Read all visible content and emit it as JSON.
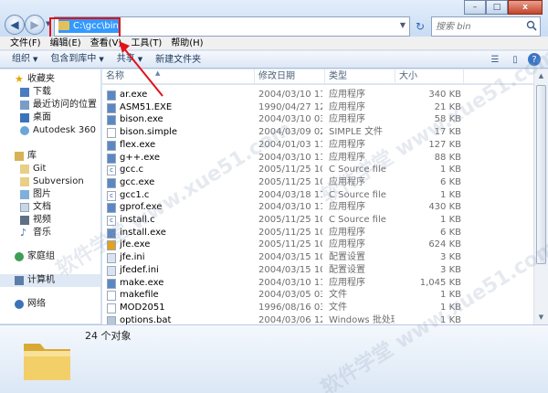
{
  "address": {
    "path": "C:\\gcc\\bin"
  },
  "search": {
    "placeholder": "搜索 bin"
  },
  "window_controls": {
    "minimize": "–",
    "maximize": "□",
    "close": "x"
  },
  "menu": [
    "文件(F)",
    "编辑(E)",
    "查看(V)",
    "工具(T)",
    "帮助(H)"
  ],
  "toolbar": {
    "organize": "组织",
    "include": "包含到库中",
    "share": "共享",
    "new_folder": "新建文件夹"
  },
  "nav": {
    "favorites": "收藏夹",
    "downloads": "下载",
    "recent": "最近访问的位置",
    "desktop": "桌面",
    "autodesk": "Autodesk 360",
    "libraries": "库",
    "git": "Git",
    "subversion": "Subversion",
    "pictures": "图片",
    "documents": "文档",
    "videos": "视频",
    "music": "音乐",
    "homegroup": "家庭组",
    "computer": "计算机",
    "network": "网络"
  },
  "columns": {
    "name": "名称",
    "date": "修改日期",
    "type": "类型",
    "size": "大小"
  },
  "files": [
    {
      "name": "ar.exe",
      "date": "2004/03/10 11:2...",
      "type": "应用程序",
      "size": "340 KB",
      "icon": "exe"
    },
    {
      "name": "ASM51.EXE",
      "date": "1990/04/27 12:4...",
      "type": "应用程序",
      "size": "21 KB",
      "icon": "exe"
    },
    {
      "name": "bison.exe",
      "date": "2004/03/10 03:4...",
      "type": "应用程序",
      "size": "58 KB",
      "icon": "exe"
    },
    {
      "name": "bison.simple",
      "date": "2004/03/09 02:5...",
      "type": "SIMPLE 文件",
      "size": "17 KB",
      "icon": "file"
    },
    {
      "name": "flex.exe",
      "date": "2004/01/03 11:0...",
      "type": "应用程序",
      "size": "127 KB",
      "icon": "exe"
    },
    {
      "name": "g++.exe",
      "date": "2004/03/10 11:2...",
      "type": "应用程序",
      "size": "88 KB",
      "icon": "exe"
    },
    {
      "name": "gcc.c",
      "date": "2005/11/25 10:0...",
      "type": "C Source file",
      "size": "1 KB",
      "icon": "c"
    },
    {
      "name": "gcc.exe",
      "date": "2005/11/25 10:0...",
      "type": "应用程序",
      "size": "6 KB",
      "icon": "exe"
    },
    {
      "name": "gcc1.c",
      "date": "2004/03/18 11:4...",
      "type": "C Source file",
      "size": "1 KB",
      "icon": "c"
    },
    {
      "name": "gprof.exe",
      "date": "2004/03/10 11:2...",
      "type": "应用程序",
      "size": "430 KB",
      "icon": "exe"
    },
    {
      "name": "install.c",
      "date": "2005/11/25 10:0...",
      "type": "C Source file",
      "size": "1 KB",
      "icon": "c"
    },
    {
      "name": "install.exe",
      "date": "2005/11/25 10:0...",
      "type": "应用程序",
      "size": "6 KB",
      "icon": "exe"
    },
    {
      "name": "jfe.exe",
      "date": "2005/11/25 10:0...",
      "type": "应用程序",
      "size": "624 KB",
      "icon": "jfe"
    },
    {
      "name": "jfe.ini",
      "date": "2004/03/15 10:1...",
      "type": "配置设置",
      "size": "3 KB",
      "icon": "ini"
    },
    {
      "name": "jfedef.ini",
      "date": "2004/03/15 10:1...",
      "type": "配置设置",
      "size": "3 KB",
      "icon": "ini"
    },
    {
      "name": "make.exe",
      "date": "2004/03/10 11:2...",
      "type": "应用程序",
      "size": "1,045 KB",
      "icon": "exe"
    },
    {
      "name": "makefile",
      "date": "2004/03/05 03:4...",
      "type": "文件",
      "size": "1 KB",
      "icon": "file"
    },
    {
      "name": "MOD2051",
      "date": "1996/08/16 03:4...",
      "type": "文件",
      "size": "1 KB",
      "icon": "file"
    },
    {
      "name": "options.bat",
      "date": "2004/03/06 12:0...",
      "type": "Windows 批处理...",
      "size": "1 KB",
      "icon": "bat"
    }
  ],
  "status": {
    "count": "24 个对象"
  },
  "watermark": "软件学堂 www.xue51.com"
}
